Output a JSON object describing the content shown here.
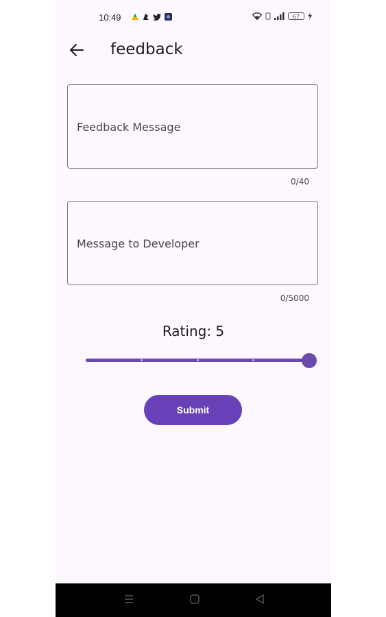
{
  "status_bar": {
    "time": "10:49",
    "battery": "67"
  },
  "app_bar": {
    "title": "feedback"
  },
  "feedback_field": {
    "label": "Feedback Message",
    "counter": "0/40"
  },
  "developer_field": {
    "label": "Message to Developer",
    "counter": "0/5000"
  },
  "rating": {
    "label": "Rating: 5",
    "value": 5,
    "min": 1,
    "max": 5
  },
  "submit": {
    "label": "Submit"
  },
  "colors": {
    "primary": "#6841b8",
    "background": "#fcf8fd"
  },
  "icons": [
    "back-arrow-icon",
    "wifi-icon",
    "signal-icon",
    "battery-icon",
    "nav-menu-icon",
    "nav-home-icon",
    "nav-back-icon"
  ]
}
